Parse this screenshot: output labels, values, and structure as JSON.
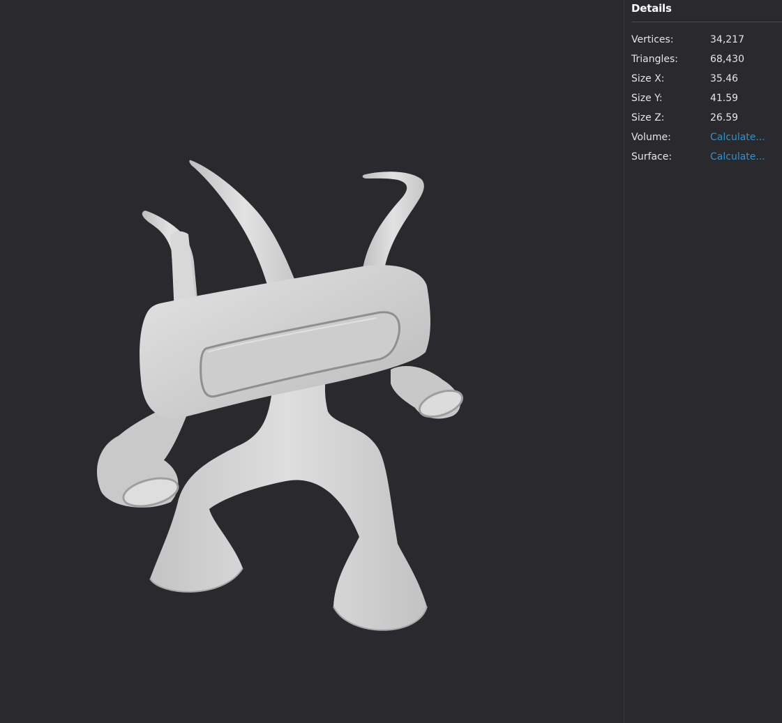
{
  "details": {
    "title": "Details",
    "rows": [
      {
        "label": "Vertices:",
        "value": "34,217"
      },
      {
        "label": "Triangles:",
        "value": "68,430"
      },
      {
        "label": "Size X:",
        "value": "35.46"
      },
      {
        "label": "Size Y:",
        "value": "41.59"
      },
      {
        "label": "Size Z:",
        "value": "26.59"
      },
      {
        "label": "Volume:",
        "value": "Calculate..."
      },
      {
        "label": "Surface:",
        "value": "Calculate..."
      }
    ]
  },
  "colors": {
    "background": "#29292e",
    "model": "#cfcfcf",
    "link": "#3a8fc7"
  }
}
